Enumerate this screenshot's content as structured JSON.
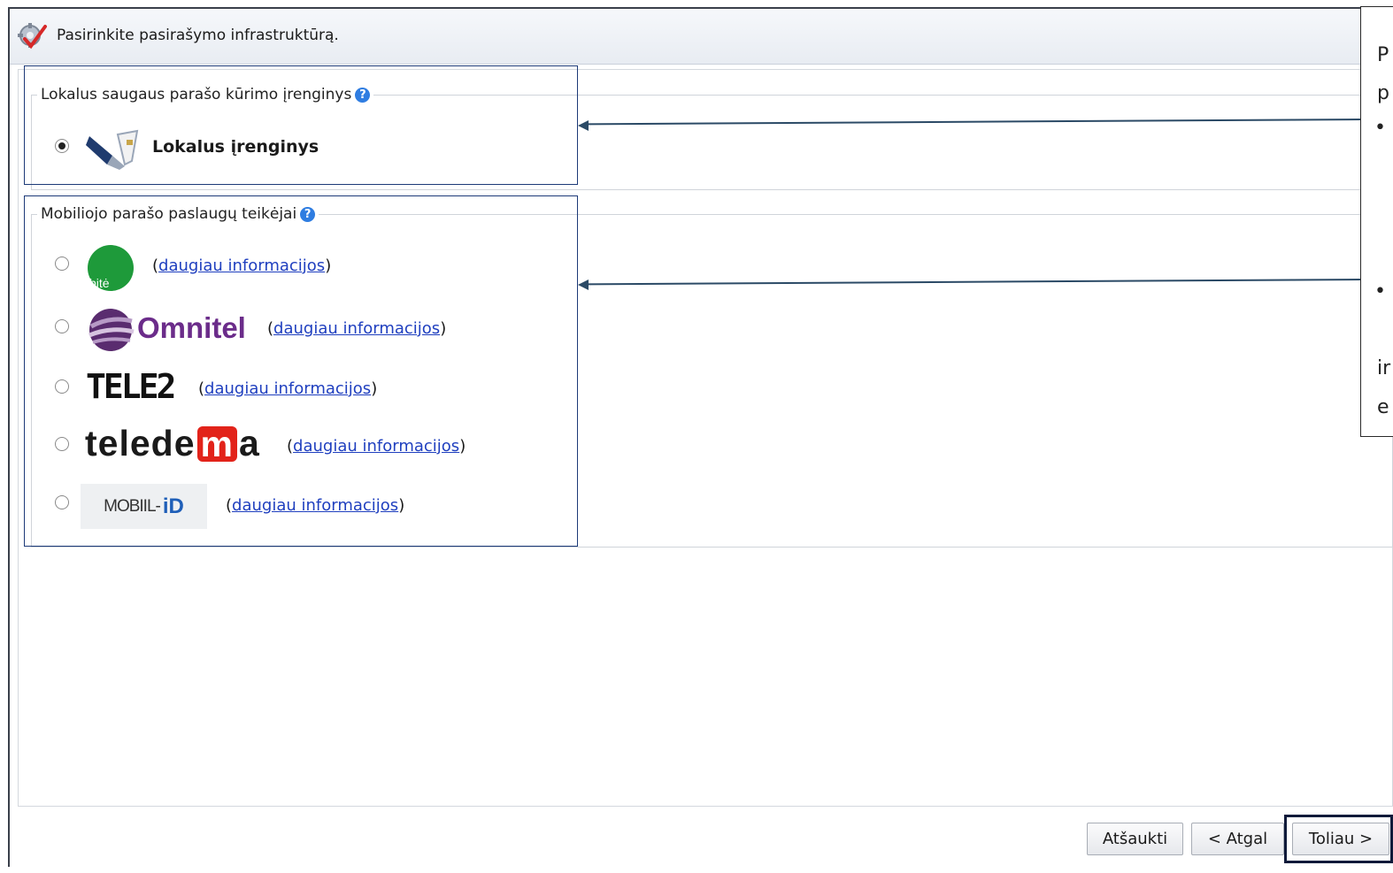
{
  "header": {
    "title": "Pasirinkite pasirašymo infrastruktūrą."
  },
  "local_section": {
    "legend": "Lokalus saugaus parašo kūrimo įrenginys",
    "device_label": "Lokalus įrenginys",
    "selected": true
  },
  "mobile_section": {
    "legend": "Mobiliojo parašo paslaugų teikėjai",
    "providers": [
      {
        "name": "bitė",
        "logo_text": "bitė",
        "link": "daugiau informacijos",
        "selected": false
      },
      {
        "name": "Omnitel",
        "logo_text": "Omnitel",
        "link": "daugiau informacijos",
        "selected": false
      },
      {
        "name": "TELE2",
        "logo_text": "TELE2",
        "link": "daugiau informacijos",
        "selected": false
      },
      {
        "name": "teledema",
        "logo_text_a": "telede",
        "logo_text_m": "m",
        "logo_text_b": "a",
        "link": "daugiau informacijos",
        "selected": false
      },
      {
        "name": "MOBIIL-ID",
        "logo_text_a": "MOBIIL-",
        "logo_text_b": "iD",
        "link": "daugiau informacijos",
        "selected": false
      }
    ]
  },
  "side_note": {
    "line1": "P",
    "line2": "p",
    "bullet1": "•",
    "bullet2": "•",
    "line3": "ir",
    "line4": "e"
  },
  "buttons": {
    "cancel": "Atšaukti",
    "back": "< Atgal",
    "next": "Toliau >"
  },
  "colors": {
    "accent_blue": "#2f7de1",
    "highlight_box": "#1d3a78",
    "arrow": "#2b4a66",
    "bite_green": "#1e9a3a",
    "omnitel_purple": "#6b2c8a",
    "teledema_red": "#e2231a"
  }
}
